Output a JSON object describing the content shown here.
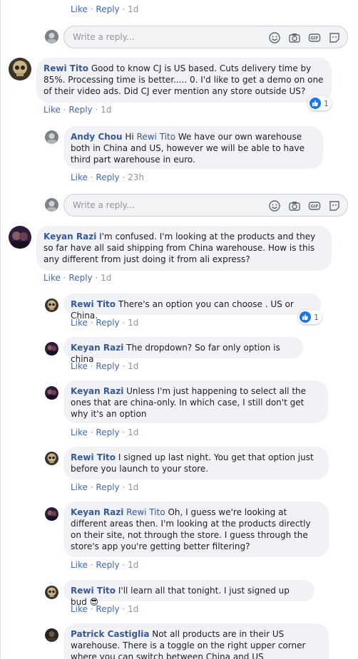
{
  "actions": {
    "like": "Like",
    "reply": "Reply",
    "sep": " · "
  },
  "reply_placeholder": "Write a reply...",
  "top_meta": {
    "time": "1d"
  },
  "comments": [
    {
      "name": "Rewi Tito",
      "text": " Good to know CJ is US based. Cuts delivery time by 85%. Processing time is better..... 0. I'd like to get a demo on one of their video ads. Did CJ ever mention any store outside US?",
      "time": "1d",
      "reactions": "1"
    },
    {
      "name": "Andy Chou",
      "text_pre": " Hi ",
      "mention": "Rewi Tito",
      "text": " We have our own warehouse both in China and US, however we will be able to have third part warehouse in euro.",
      "time": "23h"
    },
    {
      "name": "Keyan Razi",
      "text": " I'm confused. I'm looking at the products and they so far have all said shipping from China warehouse. How is this any different from just doing it from ali express?",
      "time": "1d"
    },
    {
      "name": "Rewi Tito",
      "text": " There's an option you can choose . US or China.",
      "time": "1d",
      "reactions": "1"
    },
    {
      "name": "Keyan Razi",
      "text": " The dropdown? So far only option is china",
      "time": "1d"
    },
    {
      "name": "Keyan Razi",
      "text": " Unless I'm just happening to select all the ones that are china-only. In which case, I still don't get why it's an option",
      "time": "1d"
    },
    {
      "name": "Rewi Tito",
      "text": " I signed up last night. You get that option just before you launch to your store.",
      "time": "1d"
    },
    {
      "name": "Keyan Razi",
      "mention": "Rewi Tito",
      "text": " Oh, I guess we're looking at different areas then. I'm looking at the products directly on their site, not through the store. I guess through the store's app you're getting better filtering?",
      "time": "1d"
    },
    {
      "name": "Rewi Tito",
      "text": " I'll learn all that tonight. I just signed up bud ",
      "emoji": "😎",
      "time": "1d"
    },
    {
      "name": "Patrick Castiglia",
      "text": " Not all products are in their US warehouse. There is a toggle on the right upper corner where you can switch between China and US"
    }
  ]
}
